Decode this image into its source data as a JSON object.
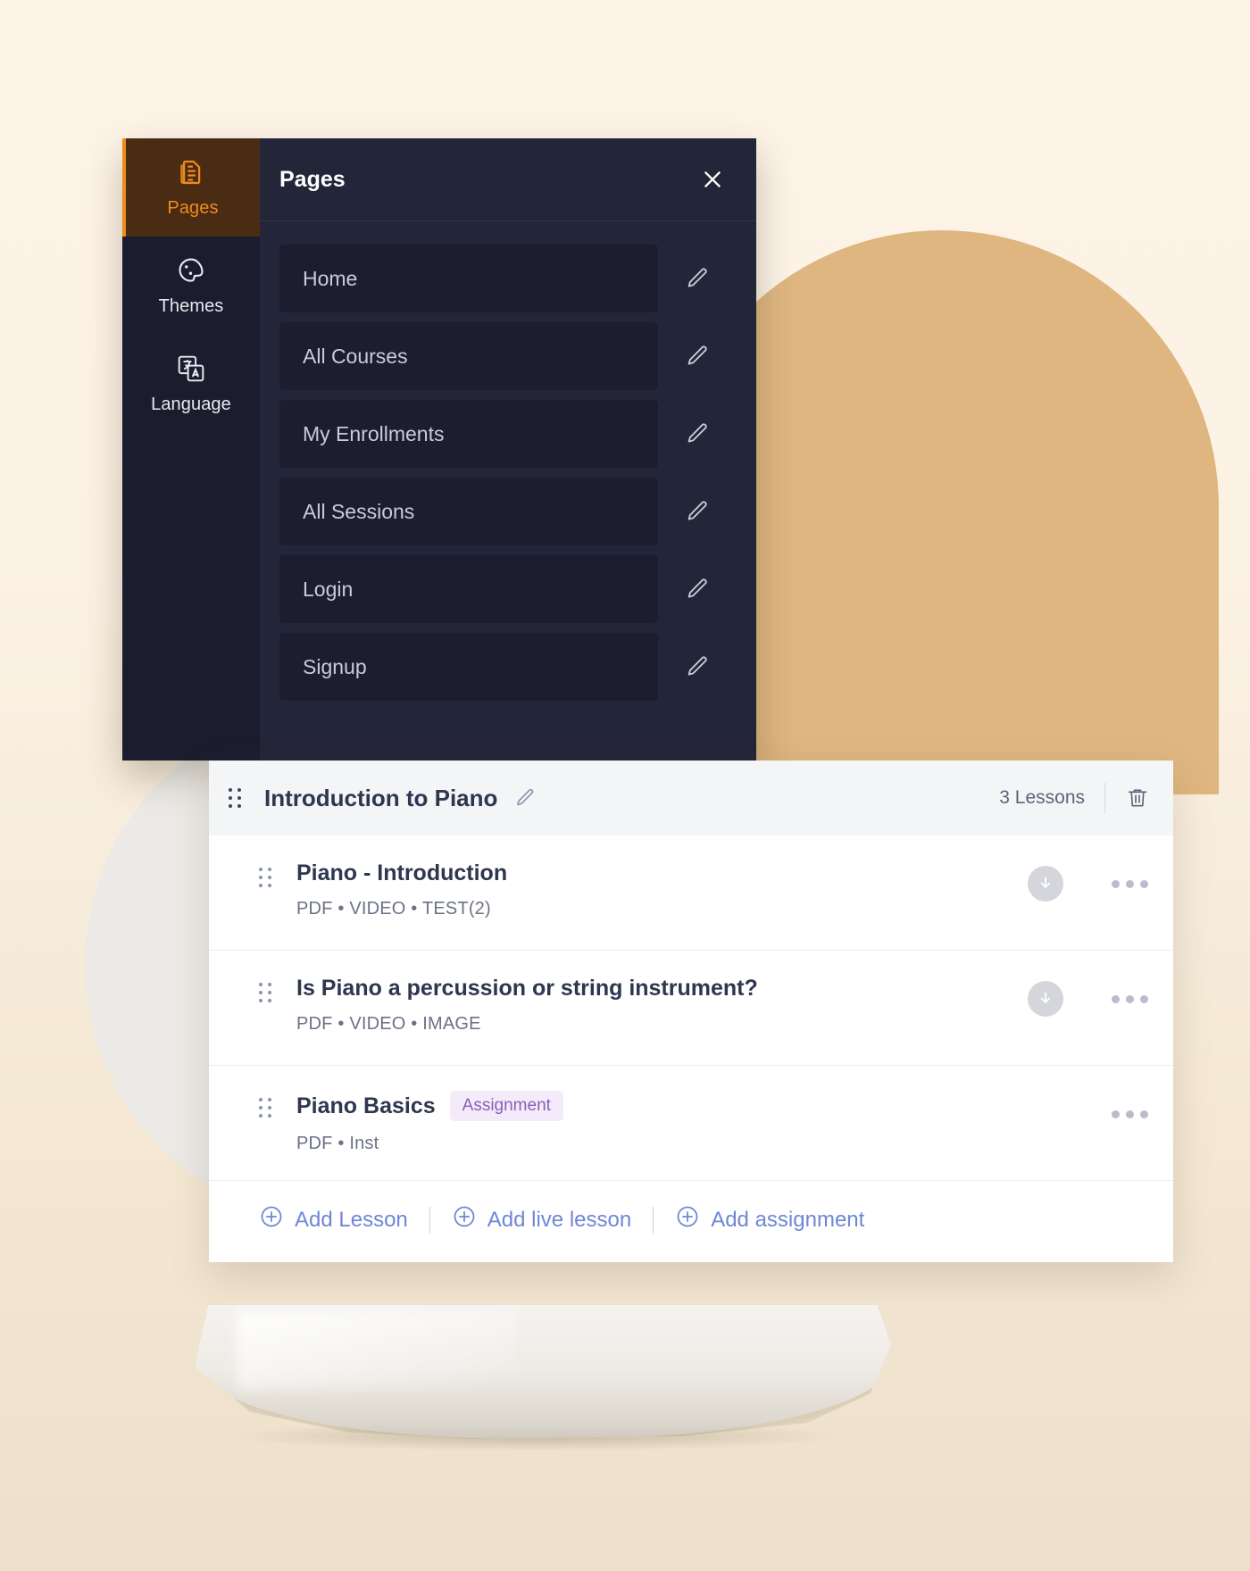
{
  "background": {
    "page_color": "#fbf1e2",
    "accent_circle_color": "#dfb680",
    "light_circle_color": "#eceae6"
  },
  "editor": {
    "rail": {
      "items": [
        {
          "label": "Pages",
          "icon": "pages-document-icon",
          "active": true
        },
        {
          "label": "Themes",
          "icon": "palette-icon",
          "active": false
        },
        {
          "label": "Language",
          "icon": "translate-icon",
          "active": false
        }
      ],
      "active_color": "#f08a1d",
      "active_bg": "#4a2c14"
    },
    "panel": {
      "title": "Pages",
      "close_icon": "close-icon",
      "pages": [
        {
          "name": "Home",
          "edit_icon": "pencil-icon"
        },
        {
          "name": "All Courses",
          "edit_icon": "pencil-icon"
        },
        {
          "name": "My Enrollments",
          "edit_icon": "pencil-icon"
        },
        {
          "name": "All Sessions",
          "edit_icon": "pencil-icon"
        },
        {
          "name": "Login",
          "edit_icon": "pencil-icon"
        },
        {
          "name": "Signup",
          "edit_icon": "pencil-icon"
        }
      ]
    }
  },
  "lesson_card": {
    "header": {
      "drag_icon": "drag-handle-icon",
      "title": "Introduction to Piano",
      "edit_icon": "pencil-icon",
      "lesson_count": "3 Lessons",
      "delete_icon": "trash-icon"
    },
    "lessons": [
      {
        "drag_icon": "drag-handle-icon",
        "title": "Piano - Introduction",
        "badge": "",
        "meta": "PDF • VIDEO • TEST(2)",
        "has_download": true,
        "download_icon": "download-icon",
        "more_icon": "more-options-icon"
      },
      {
        "drag_icon": "drag-handle-icon",
        "title": "Is Piano a percussion or string instrument?",
        "badge": "",
        "meta": "PDF • VIDEO • IMAGE",
        "has_download": true,
        "download_icon": "download-icon",
        "more_icon": "more-options-icon"
      },
      {
        "drag_icon": "drag-handle-icon",
        "title": "Piano Basics",
        "badge": "Assignment",
        "badge_color": "#8a5fb5",
        "badge_bg": "#f4ebfa",
        "meta": "PDF • Inst",
        "has_download": false,
        "download_icon": "",
        "more_icon": "more-options-icon"
      }
    ],
    "footer": {
      "link_color": "#6f86d6",
      "actions": [
        {
          "label": "Add Lesson",
          "icon": "plus-circle-icon"
        },
        {
          "label": "Add live lesson",
          "icon": "plus-circle-icon"
        },
        {
          "label": "Add assignment",
          "icon": "plus-circle-icon"
        }
      ]
    }
  }
}
